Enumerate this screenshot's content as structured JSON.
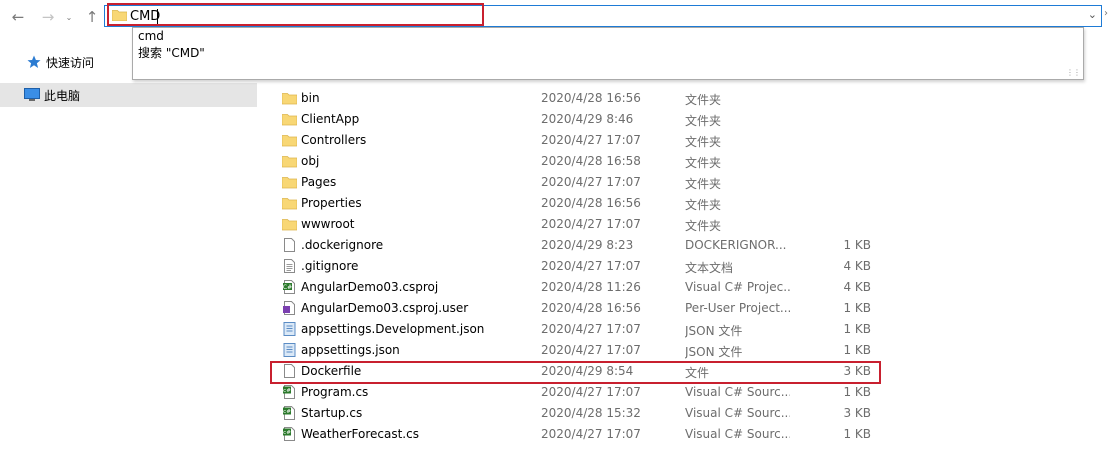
{
  "nav": {
    "back_icon": "arrow-left-icon",
    "forward_icon": "arrow-right-icon",
    "recent_icon": "chevron-down-icon",
    "up_icon": "arrow-up-icon"
  },
  "address": {
    "value": "CMD",
    "dropdown_icon": "chevron-down-icon"
  },
  "suggestions": [
    "cmd",
    "搜索 \"CMD\""
  ],
  "sidebar": {
    "items": [
      {
        "label": "快速访问",
        "icon": "star-icon"
      },
      {
        "label": "此电脑",
        "icon": "computer-icon"
      }
    ]
  },
  "files": [
    {
      "name": "bin",
      "date": "2020/4/28 16:56",
      "type": "文件夹",
      "size": "",
      "icon": "folder-icon"
    },
    {
      "name": "ClientApp",
      "date": "2020/4/29 8:46",
      "type": "文件夹",
      "size": "",
      "icon": "folder-icon"
    },
    {
      "name": "Controllers",
      "date": "2020/4/27 17:07",
      "type": "文件夹",
      "size": "",
      "icon": "folder-icon"
    },
    {
      "name": "obj",
      "date": "2020/4/28 16:58",
      "type": "文件夹",
      "size": "",
      "icon": "folder-icon"
    },
    {
      "name": "Pages",
      "date": "2020/4/27 17:07",
      "type": "文件夹",
      "size": "",
      "icon": "folder-icon"
    },
    {
      "name": "Properties",
      "date": "2020/4/28 16:56",
      "type": "文件夹",
      "size": "",
      "icon": "folder-icon"
    },
    {
      "name": "wwwroot",
      "date": "2020/4/27 17:07",
      "type": "文件夹",
      "size": "",
      "icon": "folder-icon"
    },
    {
      "name": ".dockerignore",
      "date": "2020/4/29 8:23",
      "type": "DOCKERIGNOR...",
      "size": "1 KB",
      "icon": "file-icon"
    },
    {
      "name": ".gitignore",
      "date": "2020/4/27 17:07",
      "type": "文本文档",
      "size": "4 KB",
      "icon": "text-file-icon"
    },
    {
      "name": "AngularDemo03.csproj",
      "date": "2020/4/28 11:26",
      "type": "Visual C# Projec...",
      "size": "4 KB",
      "icon": "csproj-icon"
    },
    {
      "name": "AngularDemo03.csproj.user",
      "date": "2020/4/28 16:56",
      "type": "Per-User Project...",
      "size": "1 KB",
      "icon": "vs-user-icon"
    },
    {
      "name": "appsettings.Development.json",
      "date": "2020/4/27 17:07",
      "type": "JSON 文件",
      "size": "1 KB",
      "icon": "json-file-icon"
    },
    {
      "name": "appsettings.json",
      "date": "2020/4/27 17:07",
      "type": "JSON 文件",
      "size": "1 KB",
      "icon": "json-file-icon"
    },
    {
      "name": "Dockerfile",
      "date": "2020/4/29 8:54",
      "type": "文件",
      "size": "3 KB",
      "icon": "file-icon"
    },
    {
      "name": "Program.cs",
      "date": "2020/4/27 17:07",
      "type": "Visual C# Sourc...",
      "size": "1 KB",
      "icon": "csharp-file-icon"
    },
    {
      "name": "Startup.cs",
      "date": "2020/4/28 15:32",
      "type": "Visual C# Sourc...",
      "size": "3 KB",
      "icon": "csharp-file-icon"
    },
    {
      "name": "WeatherForecast.cs",
      "date": "2020/4/27 17:07",
      "type": "Visual C# Sourc...",
      "size": "1 KB",
      "icon": "csharp-file-icon"
    }
  ],
  "colors": {
    "folder": "#f8d775",
    "highlight": "#c8202f",
    "address_border": "#1e7bd6"
  }
}
